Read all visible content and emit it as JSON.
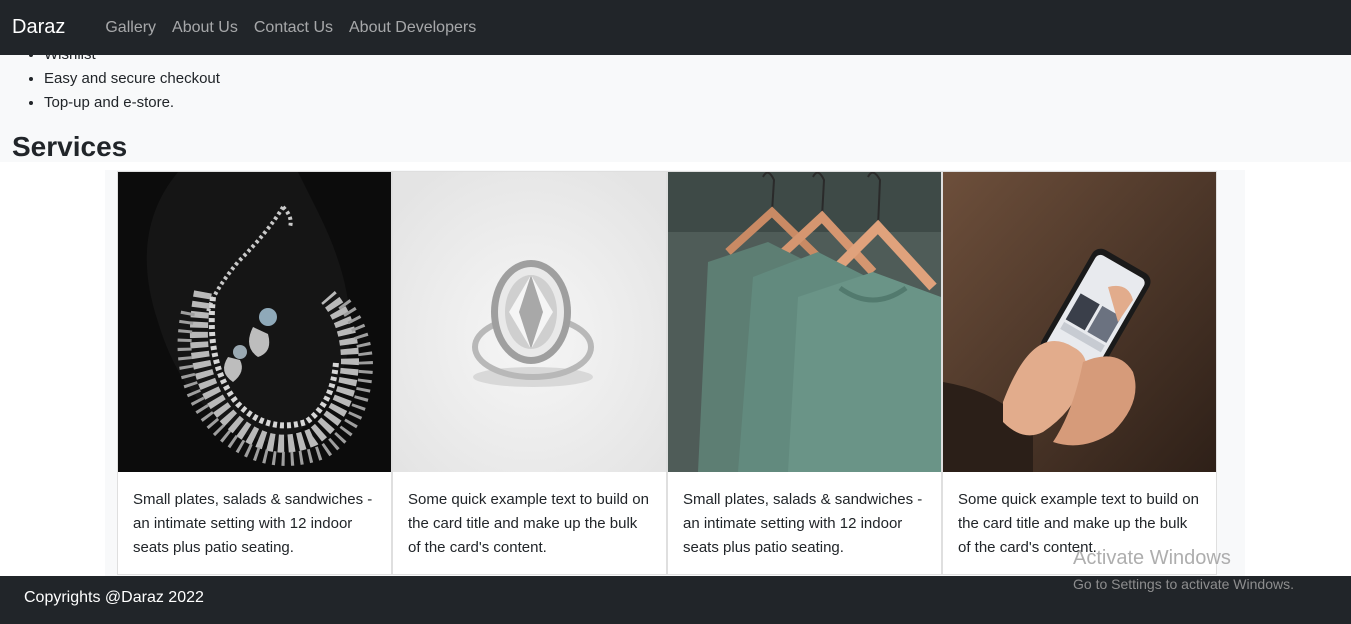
{
  "navbar": {
    "brand": "Daraz",
    "links": [
      "Gallery",
      "About Us",
      "Contact Us",
      "About Developers"
    ]
  },
  "features": [
    "Wishlist",
    "Easy and secure checkout",
    "Top-up and e-store."
  ],
  "services": {
    "title": "Services",
    "cards": [
      {
        "image": "silver-necklace-image",
        "text": "Small plates, salads & sandwiches - an intimate setting with 12 indoor seats plus patio seating."
      },
      {
        "image": "diamond-ring-image",
        "text": "Some quick example text to build on the card title and make up the bulk of the card's content."
      },
      {
        "image": "green-tshirts-hangers-image",
        "text": "Small plates, salads & sandwiches - an intimate setting with 12 indoor seats plus patio seating."
      },
      {
        "image": "phone-in-hands-image",
        "text": "Some quick example text to build on the card title and make up the bulk of the card's content."
      }
    ]
  },
  "footer": {
    "text": "Copyrights @Daraz 2022"
  },
  "watermark": {
    "title": "Activate Windows",
    "subtitle": "Go to Settings to activate Windows."
  },
  "colors": {
    "navbar": "#212529",
    "page": "#f8f9fa",
    "text": "#212529"
  }
}
